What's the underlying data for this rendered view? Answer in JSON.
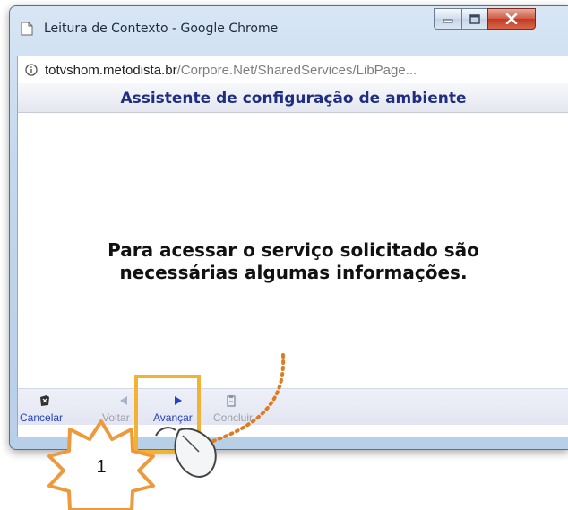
{
  "window": {
    "title": "Leitura de Contexto - Google Chrome",
    "url_host": "totvshom.metodista.br",
    "url_path": "/Corpore.Net/SharedServices/LibPage..."
  },
  "page": {
    "header": "Assistente de configuração de ambiente",
    "message_line1": "Para acessar o serviço solicitado são",
    "message_line2": "necessárias algumas informações."
  },
  "toolbar": {
    "cancel_label": "Cancelar",
    "back_label": "Voltar",
    "next_label": "Avançar",
    "finish_label": "Concluir"
  },
  "annotation": {
    "step_number": "1",
    "highlight_color": "#f2b233",
    "starburst_color": "#ee9a3c"
  },
  "colors": {
    "header_text": "#1f2e82",
    "enabled_link": "#2541c4",
    "disabled_link": "#9aa0ae",
    "close_button": "#c03b22"
  }
}
